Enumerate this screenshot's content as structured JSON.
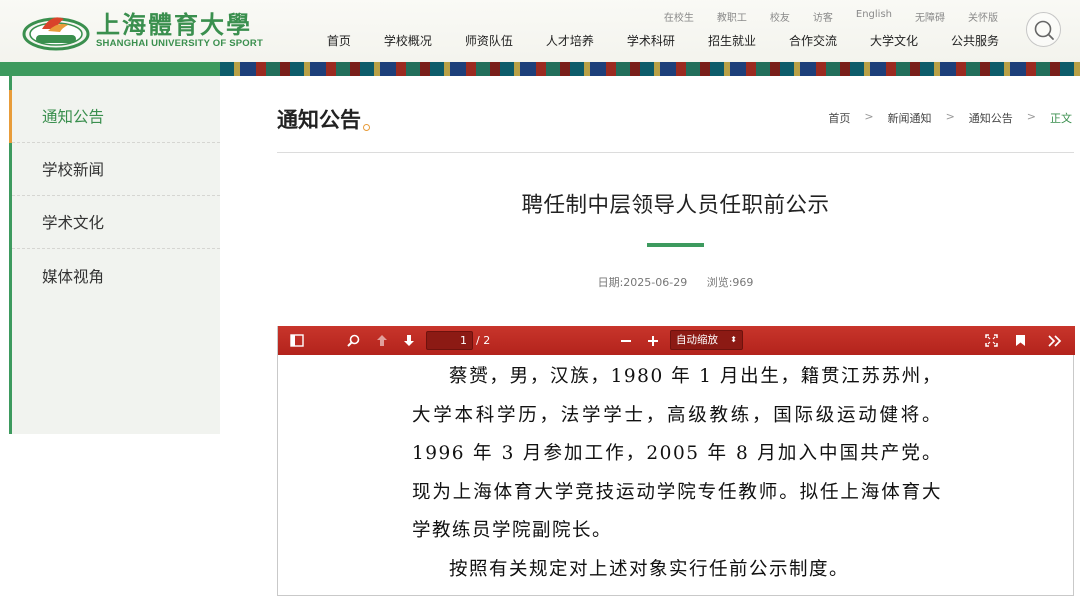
{
  "header": {
    "logo_cn": "上海體育大學",
    "logo_en": "SHANGHAI UNIVERSITY OF SPORT",
    "toplinks": [
      "在校生",
      "教职工",
      "校友",
      "访客",
      "English",
      "无障碍",
      "关怀版"
    ],
    "nav": [
      "首页",
      "学校概况",
      "师资队伍",
      "人才培养",
      "学术科研",
      "招生就业",
      "合作交流",
      "大学文化",
      "公共服务"
    ],
    "search_icon": "search-icon"
  },
  "sidebar": {
    "items": [
      {
        "label": "通知公告",
        "active": true
      },
      {
        "label": "学校新闻",
        "active": false
      },
      {
        "label": "学术文化",
        "active": false
      },
      {
        "label": "媒体视角",
        "active": false
      }
    ]
  },
  "main": {
    "section_title": "通知公告",
    "breadcrumb": [
      "首页",
      "新闻通知",
      "通知公告",
      "正文"
    ],
    "breadcrumb_sep": ">",
    "article_title": "聘任制中层领导人员任职前公示",
    "date": "日期:2025-06-29",
    "views": "浏览:969"
  },
  "pdf_viewer": {
    "page_current": "1",
    "page_total": "/ 2",
    "zoom": "自动缩放",
    "toolbar_color": "#b3231c",
    "paragraphs": [
      "蔡赟，男，汉族，1980 年 1 月出生，籍贯江苏苏州，大学本科学历，法学学士，高级教练，国际级运动健将。1996 年 3 月参加工作，2005 年 8 月加入中国共产党。现为上海体育大学竞技运动学院专任教师。拟任上海体育大学教练员学院副院长。",
      "按照有关规定对上述对象实行任前公示制度。"
    ]
  },
  "colors": {
    "brand_green": "#3d9a5e",
    "accent_orange": "#e89c3a"
  }
}
